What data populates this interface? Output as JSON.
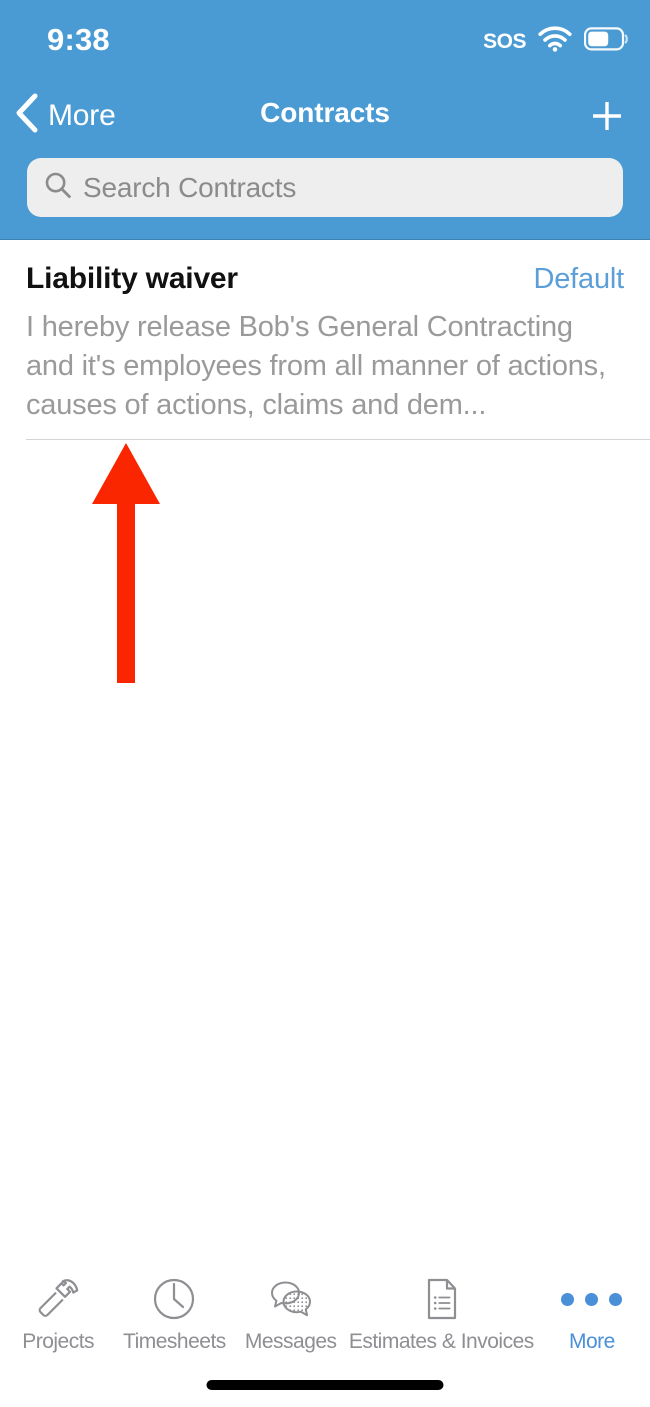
{
  "status_bar": {
    "time": "9:38",
    "sos_label": "SOS",
    "wifi_icon": "wifi-icon",
    "battery_icon": "battery-icon",
    "battery_level_percent": 62
  },
  "nav_bar": {
    "back_icon": "chevron-left-icon",
    "back_label": "More",
    "title": "Contracts",
    "add_icon": "plus-icon",
    "background_color": "#4a9bd4",
    "foreground_color": "#ffffff"
  },
  "search": {
    "icon": "search-icon",
    "placeholder": "Search Contracts",
    "value": "",
    "background_color": "#eeeeee"
  },
  "list": {
    "items": [
      {
        "title": "Liability waiver",
        "badge": "Default",
        "badge_color": "#5b9ed8",
        "preview": "I hereby release Bob's General Contracting and it's employees from all manner of actions, causes of actions, claims and dem..."
      }
    ]
  },
  "annotation": {
    "type": "arrow",
    "direction": "up",
    "color": "#fa2600"
  },
  "tab_bar": {
    "items": [
      {
        "label": "Projects",
        "icon": "hammer-icon",
        "active": false
      },
      {
        "label": "Timesheets",
        "icon": "clock-icon",
        "active": false
      },
      {
        "label": "Messages",
        "icon": "speech-bubbles-icon",
        "active": false
      },
      {
        "label": "Estimates & Invoices",
        "icon": "document-list-icon",
        "active": false
      },
      {
        "label": "More",
        "icon": "ellipsis-icon",
        "active": true
      }
    ],
    "inactive_color": "#8e8e93",
    "active_color": "#4a90d9"
  },
  "home_indicator": {
    "color": "#000000"
  }
}
